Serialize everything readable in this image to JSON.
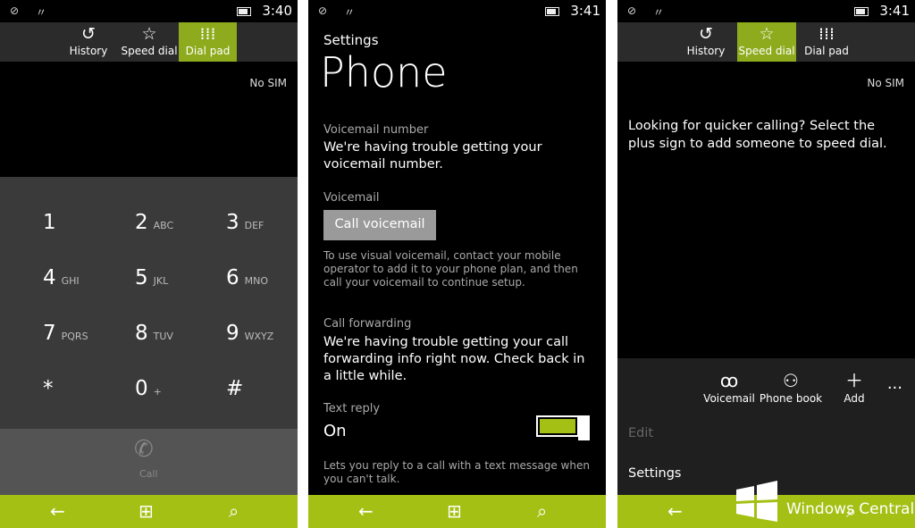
{
  "screen1": {
    "time": "3:40",
    "pivots": [
      {
        "label": "History",
        "icon": "history-icon"
      },
      {
        "label": "Speed dial",
        "icon": "star-icon"
      },
      {
        "label": "Dial pad",
        "icon": "dialpad-icon",
        "active": true
      }
    ],
    "no_sim": "No SIM",
    "keys": [
      {
        "digit": "1",
        "letters": ""
      },
      {
        "digit": "2",
        "letters": "ABC"
      },
      {
        "digit": "3",
        "letters": "DEF"
      },
      {
        "digit": "4",
        "letters": "GHI"
      },
      {
        "digit": "5",
        "letters": "JKL"
      },
      {
        "digit": "6",
        "letters": "MNO"
      },
      {
        "digit": "7",
        "letters": "PQRS"
      },
      {
        "digit": "8",
        "letters": "TUV"
      },
      {
        "digit": "9",
        "letters": "WXYZ"
      },
      {
        "digit": "*",
        "letters": ""
      },
      {
        "digit": "0",
        "letters": "+"
      },
      {
        "digit": "#",
        "letters": ""
      }
    ],
    "call_label": "Call"
  },
  "screen2": {
    "time": "3:41",
    "settings_title": "Settings",
    "page_title": "Phone",
    "voicemail_number_label": "Voicemail number",
    "voicemail_number_text": "We're having trouble getting your voicemail number.",
    "voicemail_label": "Voicemail",
    "call_voicemail_button": "Call voicemail",
    "visual_voicemail_note": "To use visual voicemail, contact your mobile operator to add it to your phone plan, and then call your voicemail to continue setup.",
    "call_forwarding_label": "Call forwarding",
    "call_forwarding_text": "We're having trouble getting your call forwarding info right now. Check back in a little while.",
    "text_reply_label": "Text reply",
    "text_reply_state": "On",
    "text_reply_note": "Lets you reply to a call with a text message when you can't talk."
  },
  "screen3": {
    "time": "3:41",
    "pivots": [
      {
        "label": "History",
        "icon": "history-icon"
      },
      {
        "label": "Speed dial",
        "icon": "star-icon",
        "active": true
      },
      {
        "label": "Dial pad",
        "icon": "dialpad-icon"
      }
    ],
    "no_sim": "No SIM",
    "message": "Looking for quicker calling? Select the plus sign to add someone to speed dial.",
    "appbar": [
      {
        "label": "Voicemail",
        "icon": "voicemail-icon"
      },
      {
        "label": "Phone book",
        "icon": "contacts-icon"
      },
      {
        "label": "Add",
        "icon": "plus-icon"
      }
    ],
    "more": "...",
    "menu_edit": "Edit",
    "menu_settings": "Settings"
  },
  "watermark": "Windows Central",
  "colors": {
    "accent": "#a4c014",
    "active_pivot": "#8dab1d",
    "dialpad_bg": "#3a3a3a"
  }
}
